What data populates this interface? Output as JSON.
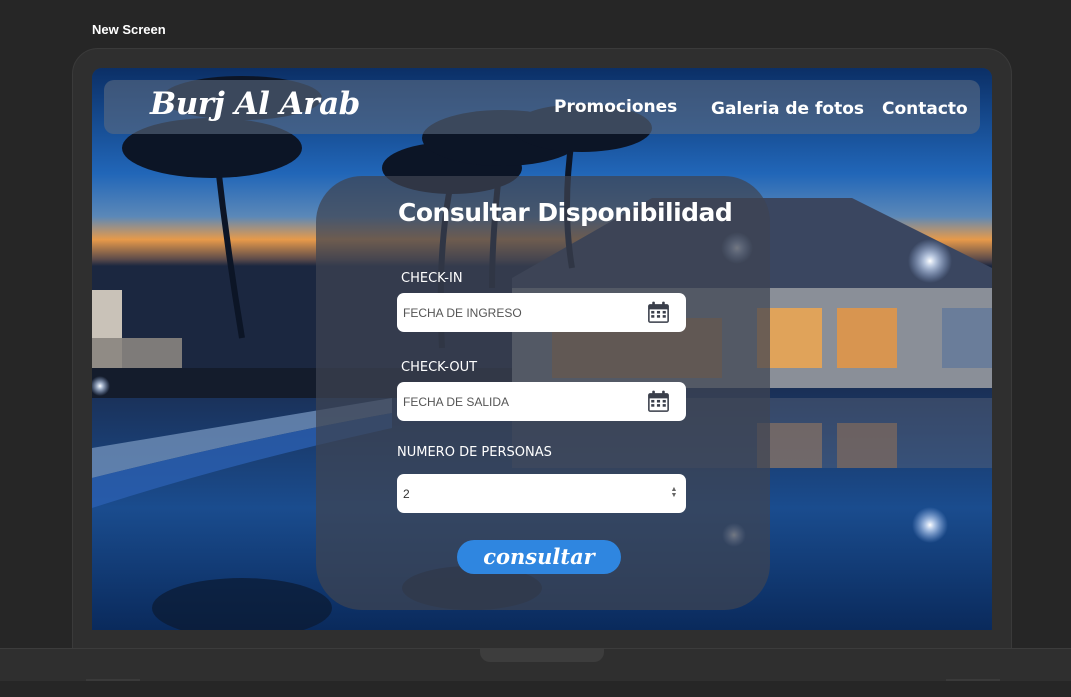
{
  "canvas": {
    "label": "New Screen"
  },
  "nav": {
    "brand": "Burj Al Arab",
    "links": [
      "Promociones",
      "Galeria de fotos",
      "Contacto"
    ]
  },
  "form": {
    "title": "Consultar Disponibilidad",
    "checkin_label": "CHECK-IN",
    "checkin_placeholder": "FECHA DE INGRESO",
    "checkout_label": "CHECK-OUT",
    "checkout_placeholder": "FECHA DE SALIDA",
    "guests_label": "NUMERO DE PERSONAS",
    "guests_value": "2",
    "submit_label": "consultar"
  },
  "icons": {
    "checkin": "calendar-icon",
    "checkout": "calendar-icon",
    "guests": "stepper-arrows-icon"
  },
  "colors": {
    "page_bg": "#262626",
    "button": "#2f86e0",
    "panel": "#3e4452",
    "text": "#ffffff"
  }
}
